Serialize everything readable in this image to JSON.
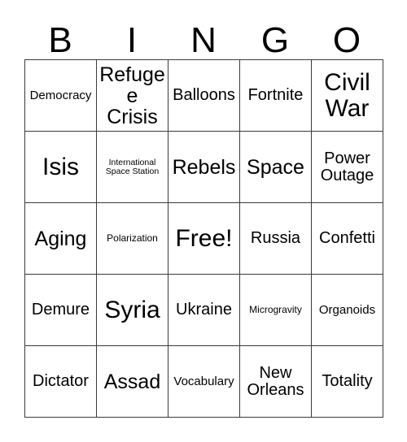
{
  "card": {
    "header_letters": [
      "B",
      "I",
      "N",
      "G",
      "O"
    ],
    "columns": 5,
    "rows": 5,
    "free_space_label": "Free!",
    "free_space_position": {
      "row": 3,
      "column": 3
    },
    "colors": {
      "background": "#ffffff",
      "text": "#000000",
      "grid_line": "#3a3a3a"
    },
    "cells": [
      {
        "text": "Democracy",
        "size": "sm"
      },
      {
        "text": "Refugee Crisis",
        "size": "lg"
      },
      {
        "text": "Balloons",
        "size": "md"
      },
      {
        "text": "Fortnite",
        "size": "md"
      },
      {
        "text": "Civil War",
        "size": "xl"
      },
      {
        "text": "Isis",
        "size": "xl"
      },
      {
        "text": "International Space Station",
        "size": "xxs"
      },
      {
        "text": "Rebels",
        "size": "lg"
      },
      {
        "text": "Space",
        "size": "lg"
      },
      {
        "text": "Power Outage",
        "size": "md"
      },
      {
        "text": "Aging",
        "size": "lg"
      },
      {
        "text": "Polarization",
        "size": "xs"
      },
      {
        "text": "Free!",
        "size": "xl"
      },
      {
        "text": "Russia",
        "size": "md"
      },
      {
        "text": "Confetti",
        "size": "md"
      },
      {
        "text": "Demure",
        "size": "md"
      },
      {
        "text": "Syria",
        "size": "xl"
      },
      {
        "text": "Ukraine",
        "size": "md"
      },
      {
        "text": "Microgravity",
        "size": "xs"
      },
      {
        "text": "Organoids",
        "size": "sm"
      },
      {
        "text": "Dictator",
        "size": "md"
      },
      {
        "text": "Assad",
        "size": "lg"
      },
      {
        "text": "Vocabulary",
        "size": "sm"
      },
      {
        "text": "New Orleans",
        "size": "md"
      },
      {
        "text": "Totality",
        "size": "md"
      }
    ]
  }
}
